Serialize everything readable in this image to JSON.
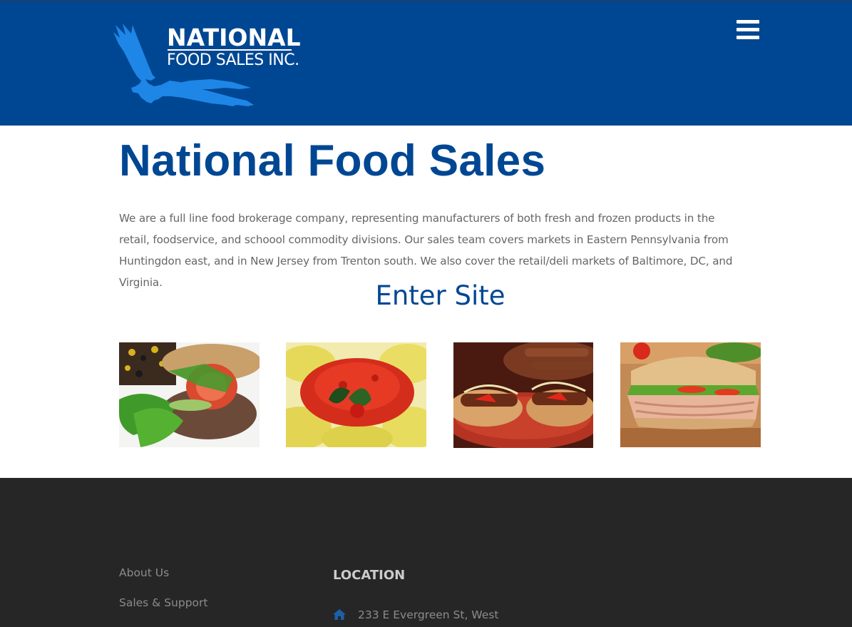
{
  "header": {
    "brand_line1": "NATIONAL",
    "brand_line2": "FOOD SALES INC.",
    "logo_icon": "eagle-icon",
    "menu_icon": "hamburger-menu-icon",
    "background_color": "#004793"
  },
  "main": {
    "title": "National Food Sales",
    "intro": "We are a full line food brokerage company, representing manufacturers of both fresh and frozen products in the retail, foodservice, and schoool commodity divisions. Our sales team covers markets in Eastern Pennsylvania from Huntingdon east, and in New Jersey from Trenton south. We also cover the retail/deli markets of Baltimore, DC, and Virginia.",
    "enter_site_label": "Enter Site",
    "accent_color": "#004793",
    "images": [
      {
        "name": "burger-image"
      },
      {
        "name": "ravioli-image"
      },
      {
        "name": "sausage-image"
      },
      {
        "name": "sandwich-image"
      }
    ]
  },
  "footer": {
    "links": [
      {
        "label": "About Us"
      },
      {
        "label": "Sales & Support"
      }
    ],
    "location_heading": "LOCATION",
    "location_icon": "home-icon",
    "address": "233 E Evergreen St, West",
    "background_color": "#262626"
  }
}
